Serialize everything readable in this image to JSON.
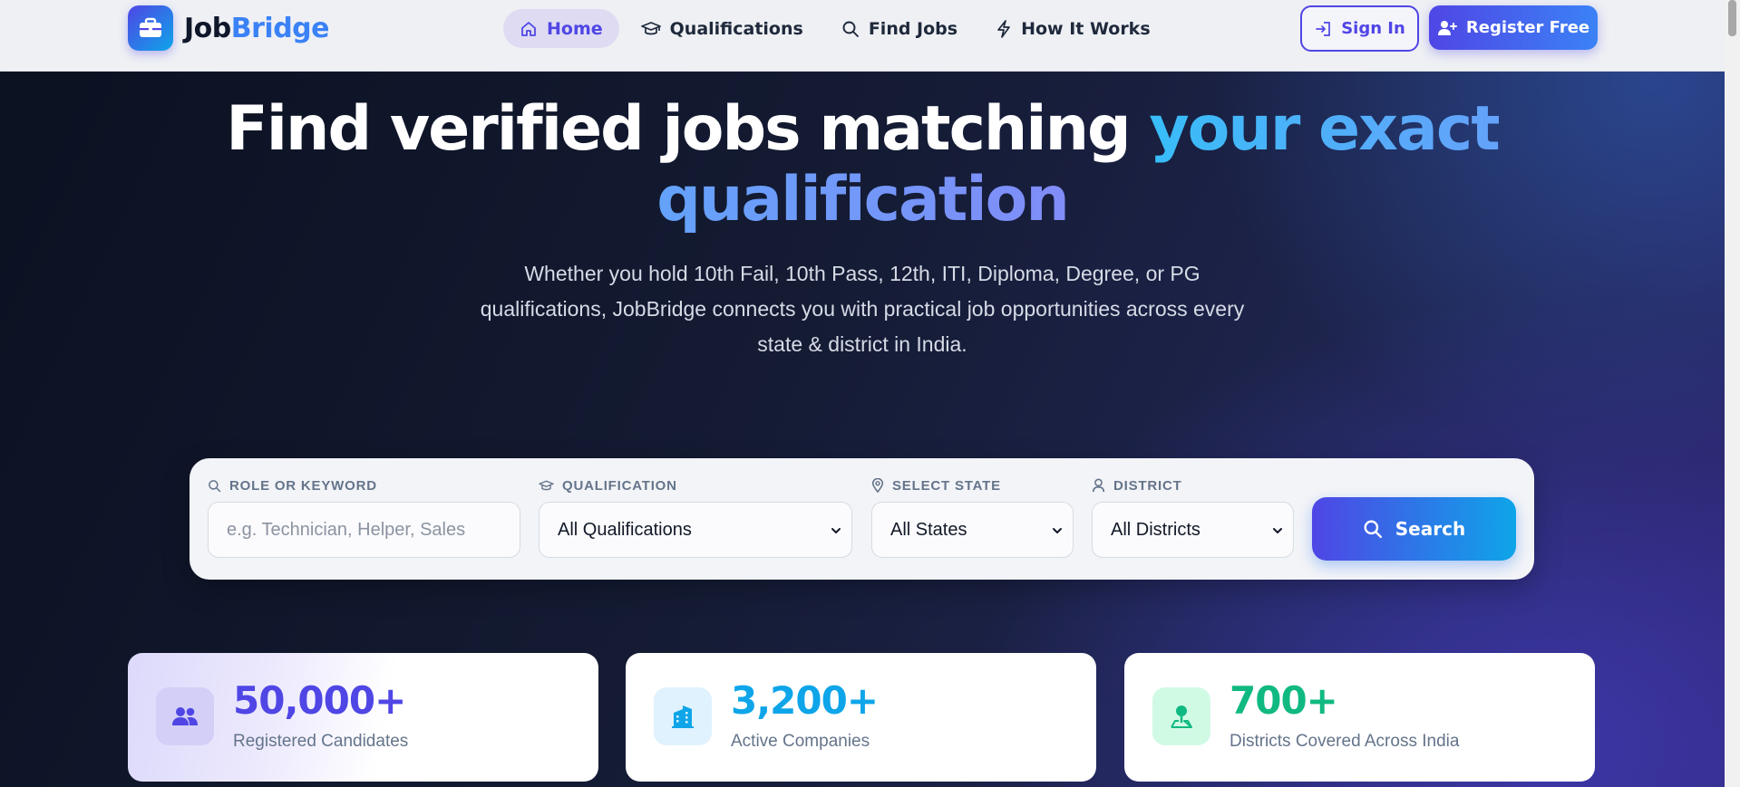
{
  "header": {
    "brand": {
      "part1": "Job",
      "part2": "Bridge"
    },
    "nav": [
      {
        "label": "Home",
        "icon": "home-icon",
        "active": true
      },
      {
        "label": "Qualifications",
        "icon": "graduation-cap-icon",
        "active": false
      },
      {
        "label": "Find Jobs",
        "icon": "search-icon",
        "active": false
      },
      {
        "label": "How It Works",
        "icon": "bolt-icon",
        "active": false
      }
    ],
    "sign_in_label": "Sign In",
    "register_label": "Register Free"
  },
  "hero": {
    "title_plain": "Find verified jobs matching ",
    "title_accent": "your exact qualification",
    "subtitle": "Whether you hold 10th Fail, 10th Pass, 12th, ITI, Diploma, Degree, or PG qualifications, JobBridge connects you with practical job opportunities across every state & district in India."
  },
  "search": {
    "keyword_label": "ROLE OR KEYWORD",
    "keyword_placeholder": "e.g. Technician, Helper, Sales",
    "qualification_label": "QUALIFICATION",
    "qualification_value": "All Qualifications",
    "state_label": "SELECT STATE",
    "state_value": "All States",
    "district_label": "DISTRICT",
    "district_value": "All Districts",
    "button_label": "Search"
  },
  "stats": [
    {
      "value": "50,000+",
      "label": "Registered Candidates",
      "icon": "users-icon",
      "color": "#4f46e5"
    },
    {
      "value": "3,200+",
      "label": "Active Companies",
      "icon": "building-icon",
      "color": "#0ea5e9"
    },
    {
      "value": "700+",
      "label": "Districts Covered Across India",
      "icon": "map-pin-icon",
      "color": "#10b981"
    }
  ],
  "colors": {
    "primary": "#4f46e5",
    "accent_blue": "#3b82f6",
    "sky": "#0ea5e9",
    "green": "#10b981"
  }
}
